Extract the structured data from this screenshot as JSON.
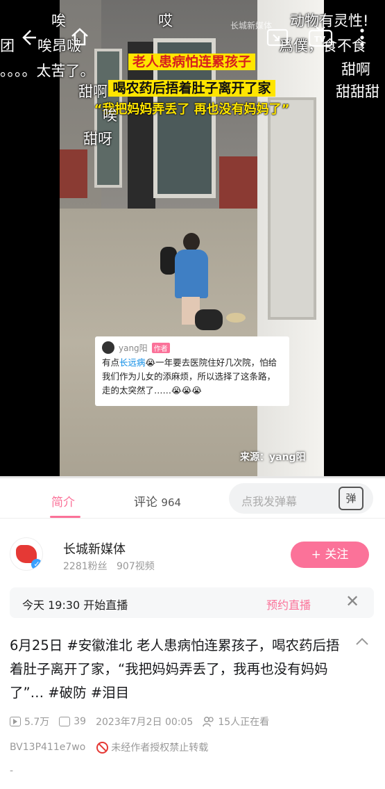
{
  "player": {
    "caption_line1": "老人患病怕连累孩子",
    "caption_line2": "喝农药后捂着肚子离开了家",
    "caption_line3": "“我把妈妈弄丢了 再也没有妈妈了”",
    "watermark": "长城新媒体",
    "source_credit": "来源：yang阳",
    "progress_fraction": 0.0,
    "controls": {
      "back_icon": "back-arrow-icon",
      "home_icon": "home-icon",
      "pip_icon": "picture-in-picture-icon",
      "tv_icon": "tv-cast-icon",
      "tv_label": "TV",
      "more_icon": "more-vertical-icon"
    },
    "pinned_comment": {
      "author": "yang阳",
      "badge": "作者",
      "text_pre": "有点",
      "highlight": "长远病",
      "text_post": "😭一年要去医院住好几次院，怕给我们作为儿女的添麻烦，所以选择了这条路，走的太突然了……😭😭😭"
    },
    "danmaku": [
      {
        "text": "唉"
      },
      {
        "text": "哎"
      },
      {
        "text": "动物有灵性!"
      },
      {
        "text": "团"
      },
      {
        "text": "唉昂啵"
      },
      {
        "text": "爲僕，食不食"
      },
      {
        "text": "。。。。太苦了。"
      },
      {
        "text": "甜啊"
      },
      {
        "text": "甜啊"
      },
      {
        "text": "甜甜甜"
      },
      {
        "text": "唉"
      },
      {
        "text": "甜呀"
      }
    ]
  },
  "tabs": {
    "intro": "简介",
    "comments_label": "评论",
    "comments_count": "964",
    "danmaku_placeholder": "点我发弹幕",
    "danmaku_button": "弹"
  },
  "uploader": {
    "name": "长城新媒体",
    "fans": "2281粉丝",
    "videos": "907视频",
    "follow_label": "+ 关注"
  },
  "live_notice": {
    "text": "今天 19:30 开始直播",
    "reserve_label": "预约直播",
    "close_label": "✕"
  },
  "description": {
    "title": "6月25日 #安徽淮北 老人患病怕连累孩子，喝农药后捂着肚子离开了家，“我把妈妈弄丢了，我再也没有妈妈了”… #破防 #泪目",
    "views": "5.7万",
    "danmaku_count": "39",
    "date": "2023年7月2日 00:05",
    "watching": "15人正在看",
    "bvid": "BV13P411e7wo",
    "copyright": "未经作者授权禁止转载",
    "trailing": "-"
  },
  "colors": {
    "accent": "#fb7299",
    "caption_bg": "#ffe500",
    "caption_red": "#d61e1e",
    "link_blue": "#0c8ce6"
  }
}
